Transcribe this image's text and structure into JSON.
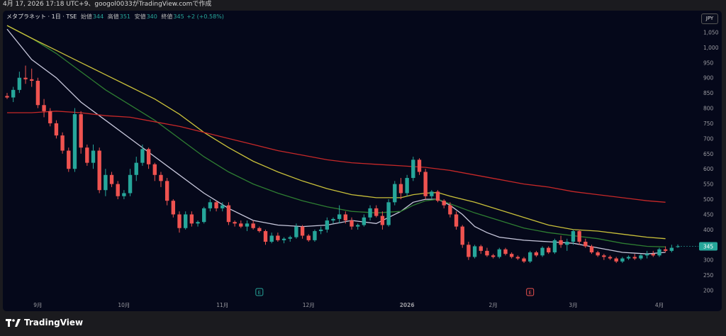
{
  "topbar": {
    "text": "4月 17, 2026 17:18 UTC+9、googol0033がTradingView.comで作成"
  },
  "header": {
    "symbol": "メタプラネット · 1日 · TSE",
    "open_label": "始値",
    "open": "344",
    "high_label": "高値",
    "high": "351",
    "low_label": "安値",
    "low": "340",
    "close_label": "終値",
    "close": "345",
    "change": "+2 (+0.58%)"
  },
  "currency": "JPY",
  "footer": {
    "brand": "TradingView"
  },
  "colors": {
    "up": "#26a69a",
    "down": "#ef5350",
    "ma_fast": "#c8c8dc",
    "ma_mid": "#2e7d32",
    "ma_slow": "#c9c03a",
    "ma_long": "#c62828",
    "background": "#05081a"
  },
  "chart_data": {
    "type": "candlestick",
    "title": "",
    "y_ticks": [
      "1,050",
      "1,000",
      "950",
      "900",
      "850",
      "800",
      "750",
      "700",
      "650",
      "600",
      "550",
      "500",
      "450",
      "400",
      "350",
      "300",
      "250",
      "200"
    ],
    "y_tick_values": [
      1050,
      1000,
      950,
      900,
      850,
      800,
      750,
      700,
      650,
      600,
      550,
      500,
      450,
      400,
      350,
      300,
      250,
      200
    ],
    "ylim": [
      178,
      1072
    ],
    "x_ticks": [
      "9月",
      "10月",
      "11月",
      "12月",
      "2026",
      "2月",
      "3月",
      "4月"
    ],
    "x_tick_bar_index": [
      5,
      19,
      35,
      49,
      65,
      79,
      92,
      106
    ],
    "last_price_label": "345",
    "event_markers": [
      {
        "label": "E",
        "bar_index": 41,
        "type": "up"
      },
      {
        "label": "E",
        "bar_index": 85,
        "type": "down"
      }
    ],
    "candles": [
      [
        840,
        850,
        830,
        835
      ],
      [
        835,
        870,
        820,
        860
      ],
      [
        860,
        920,
        850,
        900
      ],
      [
        900,
        940,
        880,
        895
      ],
      [
        895,
        930,
        870,
        890
      ],
      [
        890,
        900,
        800,
        810
      ],
      [
        810,
        830,
        770,
        790
      ],
      [
        790,
        800,
        740,
        750
      ],
      [
        750,
        760,
        700,
        710
      ],
      [
        710,
        720,
        650,
        660
      ],
      [
        660,
        670,
        590,
        600
      ],
      [
        600,
        800,
        590,
        780
      ],
      [
        780,
        790,
        650,
        670
      ],
      [
        670,
        680,
        610,
        620
      ],
      [
        620,
        680,
        600,
        660
      ],
      [
        660,
        670,
        520,
        530
      ],
      [
        530,
        600,
        510,
        580
      ],
      [
        580,
        590,
        540,
        550
      ],
      [
        550,
        560,
        500,
        510
      ],
      [
        510,
        530,
        500,
        520
      ],
      [
        520,
        600,
        510,
        580
      ],
      [
        580,
        640,
        560,
        620
      ],
      [
        620,
        680,
        610,
        665
      ],
      [
        665,
        670,
        600,
        615
      ],
      [
        615,
        620,
        560,
        580
      ],
      [
        580,
        590,
        540,
        560
      ],
      [
        560,
        570,
        480,
        495
      ],
      [
        495,
        500,
        440,
        450
      ],
      [
        450,
        460,
        390,
        405
      ],
      [
        405,
        460,
        400,
        450
      ],
      [
        450,
        460,
        410,
        420
      ],
      [
        420,
        430,
        410,
        425
      ],
      [
        425,
        475,
        420,
        470
      ],
      [
        470,
        500,
        460,
        490
      ],
      [
        490,
        495,
        460,
        470
      ],
      [
        470,
        490,
        460,
        480
      ],
      [
        480,
        490,
        415,
        425
      ],
      [
        425,
        430,
        410,
        420
      ],
      [
        420,
        430,
        405,
        410
      ],
      [
        410,
        430,
        395,
        420
      ],
      [
        420,
        430,
        400,
        405
      ],
      [
        405,
        410,
        390,
        395
      ],
      [
        395,
        400,
        350,
        360
      ],
      [
        360,
        390,
        355,
        380
      ],
      [
        380,
        390,
        360,
        365
      ],
      [
        365,
        375,
        355,
        370
      ],
      [
        370,
        380,
        360,
        375
      ],
      [
        375,
        420,
        370,
        410
      ],
      [
        410,
        415,
        370,
        380
      ],
      [
        380,
        385,
        360,
        365
      ],
      [
        365,
        400,
        360,
        395
      ],
      [
        395,
        410,
        385,
        400
      ],
      [
        400,
        440,
        390,
        430
      ],
      [
        430,
        440,
        420,
        435
      ],
      [
        435,
        480,
        420,
        450
      ],
      [
        450,
        460,
        420,
        430
      ],
      [
        430,
        440,
        400,
        410
      ],
      [
        410,
        420,
        400,
        415
      ],
      [
        415,
        450,
        410,
        440
      ],
      [
        440,
        480,
        430,
        470
      ],
      [
        470,
        480,
        440,
        445
      ],
      [
        445,
        460,
        400,
        415
      ],
      [
        415,
        500,
        410,
        490
      ],
      [
        490,
        560,
        480,
        550
      ],
      [
        550,
        570,
        500,
        520
      ],
      [
        520,
        580,
        510,
        570
      ],
      [
        570,
        640,
        560,
        630
      ],
      [
        630,
        635,
        580,
        590
      ],
      [
        590,
        600,
        500,
        510
      ],
      [
        510,
        530,
        500,
        525
      ],
      [
        525,
        530,
        490,
        495
      ],
      [
        495,
        500,
        470,
        480
      ],
      [
        480,
        490,
        440,
        450
      ],
      [
        450,
        460,
        400,
        410
      ],
      [
        410,
        415,
        340,
        350
      ],
      [
        350,
        360,
        300,
        310
      ],
      [
        310,
        350,
        305,
        345
      ],
      [
        345,
        350,
        320,
        330
      ],
      [
        330,
        340,
        310,
        315
      ],
      [
        315,
        320,
        305,
        310
      ],
      [
        310,
        340,
        305,
        335
      ],
      [
        335,
        340,
        315,
        320
      ],
      [
        320,
        325,
        305,
        310
      ],
      [
        310,
        315,
        300,
        305
      ],
      [
        305,
        310,
        290,
        295
      ],
      [
        295,
        330,
        290,
        325
      ],
      [
        325,
        330,
        310,
        315
      ],
      [
        315,
        345,
        310,
        340
      ],
      [
        340,
        345,
        320,
        325
      ],
      [
        325,
        370,
        320,
        365
      ],
      [
        365,
        380,
        340,
        350
      ],
      [
        350,
        370,
        330,
        360
      ],
      [
        360,
        400,
        350,
        395
      ],
      [
        395,
        400,
        350,
        360
      ],
      [
        360,
        370,
        340,
        345
      ],
      [
        345,
        350,
        320,
        325
      ],
      [
        325,
        330,
        310,
        315
      ],
      [
        315,
        320,
        300,
        310
      ],
      [
        310,
        315,
        300,
        305
      ],
      [
        305,
        310,
        290,
        295
      ],
      [
        295,
        310,
        290,
        305
      ],
      [
        305,
        315,
        300,
        310
      ],
      [
        310,
        320,
        300,
        305
      ],
      [
        305,
        320,
        300,
        315
      ],
      [
        315,
        330,
        305,
        320
      ],
      [
        320,
        330,
        310,
        315
      ],
      [
        315,
        340,
        310,
        335
      ],
      [
        335,
        345,
        325,
        330
      ],
      [
        330,
        350,
        325,
        340
      ],
      [
        344,
        351,
        340,
        345
      ]
    ],
    "ma_series": [
      {
        "color": "#c8c8dc",
        "points": [
          [
            0,
            1060
          ],
          [
            4,
            960
          ],
          [
            8,
            900
          ],
          [
            12,
            820
          ],
          [
            16,
            760
          ],
          [
            20,
            700
          ],
          [
            24,
            640
          ],
          [
            28,
            580
          ],
          [
            32,
            520
          ],
          [
            36,
            470
          ],
          [
            40,
            430
          ],
          [
            44,
            415
          ],
          [
            48,
            410
          ],
          [
            52,
            415
          ],
          [
            56,
            430
          ],
          [
            60,
            420
          ],
          [
            64,
            460
          ],
          [
            66,
            490
          ],
          [
            68,
            500
          ],
          [
            70,
            500
          ],
          [
            72,
            480
          ],
          [
            74,
            450
          ],
          [
            76,
            410
          ],
          [
            78,
            390
          ],
          [
            80,
            375
          ],
          [
            84,
            365
          ],
          [
            88,
            360
          ],
          [
            92,
            355
          ],
          [
            96,
            340
          ],
          [
            100,
            325
          ],
          [
            104,
            320
          ],
          [
            107,
            325
          ]
        ]
      },
      {
        "color": "#2e7d32",
        "points": [
          [
            0,
            1072
          ],
          [
            4,
            1030
          ],
          [
            8,
            980
          ],
          [
            12,
            920
          ],
          [
            16,
            860
          ],
          [
            20,
            810
          ],
          [
            24,
            760
          ],
          [
            28,
            700
          ],
          [
            32,
            640
          ],
          [
            36,
            590
          ],
          [
            40,
            550
          ],
          [
            44,
            520
          ],
          [
            48,
            495
          ],
          [
            52,
            475
          ],
          [
            56,
            460
          ],
          [
            60,
            455
          ],
          [
            64,
            460
          ],
          [
            66,
            480
          ],
          [
            68,
            495
          ],
          [
            70,
            500
          ],
          [
            72,
            485
          ],
          [
            76,
            455
          ],
          [
            80,
            430
          ],
          [
            84,
            405
          ],
          [
            88,
            390
          ],
          [
            92,
            380
          ],
          [
            96,
            370
          ],
          [
            100,
            355
          ],
          [
            104,
            345
          ],
          [
            107,
            343
          ]
        ]
      },
      {
        "color": "#c9c03a",
        "points": [
          [
            0,
            1072
          ],
          [
            4,
            1030
          ],
          [
            8,
            990
          ],
          [
            12,
            950
          ],
          [
            16,
            910
          ],
          [
            20,
            870
          ],
          [
            24,
            830
          ],
          [
            28,
            780
          ],
          [
            32,
            720
          ],
          [
            36,
            670
          ],
          [
            40,
            625
          ],
          [
            44,
            590
          ],
          [
            48,
            560
          ],
          [
            52,
            535
          ],
          [
            56,
            515
          ],
          [
            60,
            505
          ],
          [
            64,
            505
          ],
          [
            66,
            515
          ],
          [
            68,
            520
          ],
          [
            70,
            522
          ],
          [
            72,
            510
          ],
          [
            76,
            490
          ],
          [
            80,
            465
          ],
          [
            84,
            440
          ],
          [
            88,
            415
          ],
          [
            92,
            400
          ],
          [
            96,
            395
          ],
          [
            100,
            385
          ],
          [
            104,
            375
          ],
          [
            107,
            370
          ]
        ]
      },
      {
        "color": "#c62828",
        "points": [
          [
            0,
            785
          ],
          [
            4,
            785
          ],
          [
            8,
            790
          ],
          [
            12,
            785
          ],
          [
            16,
            775
          ],
          [
            20,
            770
          ],
          [
            24,
            755
          ],
          [
            28,
            740
          ],
          [
            32,
            720
          ],
          [
            36,
            700
          ],
          [
            40,
            680
          ],
          [
            44,
            660
          ],
          [
            48,
            645
          ],
          [
            52,
            630
          ],
          [
            56,
            620
          ],
          [
            60,
            615
          ],
          [
            64,
            610
          ],
          [
            68,
            605
          ],
          [
            72,
            595
          ],
          [
            76,
            580
          ],
          [
            80,
            565
          ],
          [
            84,
            550
          ],
          [
            88,
            540
          ],
          [
            92,
            525
          ],
          [
            96,
            515
          ],
          [
            100,
            505
          ],
          [
            104,
            495
          ],
          [
            107,
            490
          ]
        ]
      }
    ]
  }
}
